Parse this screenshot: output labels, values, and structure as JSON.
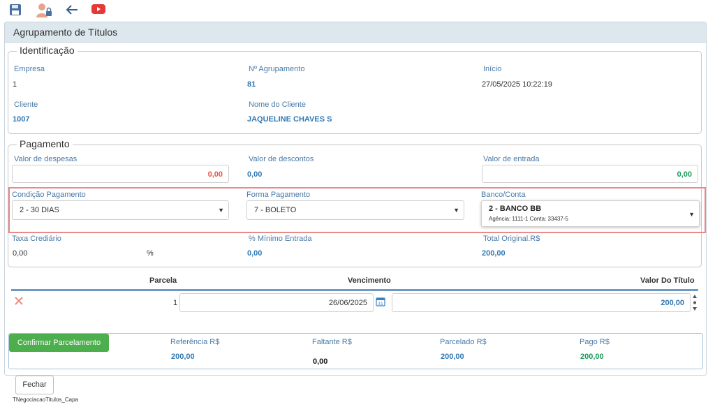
{
  "toolbar": {
    "save_icon": "save-icon",
    "user_lock_icon": "user-lock-icon",
    "back_icon": "back-arrow-icon",
    "youtube_icon": "youtube-icon"
  },
  "panel": {
    "title": "Agrupamento de Títulos"
  },
  "identificacao": {
    "legend": "Identificação",
    "empresa_label": "Empresa",
    "empresa_value": "1",
    "agrupamento_label": "Nº Agrupamento",
    "agrupamento_value": "81",
    "inicio_label": "Início",
    "inicio_value": "27/05/2025 10:22:19",
    "cliente_label": "Cliente",
    "cliente_value": "1007",
    "nome_cliente_label": "Nome do Cliente",
    "nome_cliente_value": "JAQUELINE CHAVES S"
  },
  "pagamento": {
    "legend": "Pagamento",
    "despesas_label": "Valor de despesas",
    "despesas_value": "0,00",
    "descontos_label": "Valor de descontos",
    "descontos_value": "0,00",
    "entrada_label": "Valor de entrada",
    "entrada_value": "0,00",
    "condicao_label": "Condição Pagamento",
    "condicao_value": "2 - 30 DIAS",
    "forma_label": "Forma Pagamento",
    "forma_value": "7 - BOLETO",
    "banco_label": "Banco/Conta",
    "banco_value": "2 - BANCO BB",
    "banco_detail": "Agência: 1111-1 Conta: 33437-5",
    "taxa_label": "Taxa Crediário",
    "taxa_value": "0,00",
    "taxa_unit": "%",
    "minimo_label": "% Mínimo Entrada",
    "minimo_value": "0,00",
    "total_label": "Total Original.R$",
    "total_value": "200,00"
  },
  "parcelas": {
    "col_parcela": "Parcela",
    "col_vencimento": "Vencimento",
    "col_valor": "Valor Do Título",
    "rows": [
      {
        "parcela": "1",
        "vencimento": "26/06/2025",
        "valor": "200,00"
      }
    ]
  },
  "resumo": {
    "confirm_label": "Confirmar Parcelamento",
    "referencia_label": "Referência R$",
    "referencia_value": "200,00",
    "faltante_label": "Faltante R$",
    "faltante_value": "0,00",
    "parcelado_label": "Parcelado R$",
    "parcelado_value": "200,00",
    "pago_label": "Pago R$",
    "pago_value": "200,00"
  },
  "footer": {
    "close_label": "Fechar",
    "form_name": "TNegociacaoTitulos_Capa"
  },
  "colors": {
    "red": "#e8554e",
    "green": "#1a9a5a",
    "blue": "#2f78b3",
    "button_green": "#4cae4c",
    "highlight": "#e98a8a"
  }
}
